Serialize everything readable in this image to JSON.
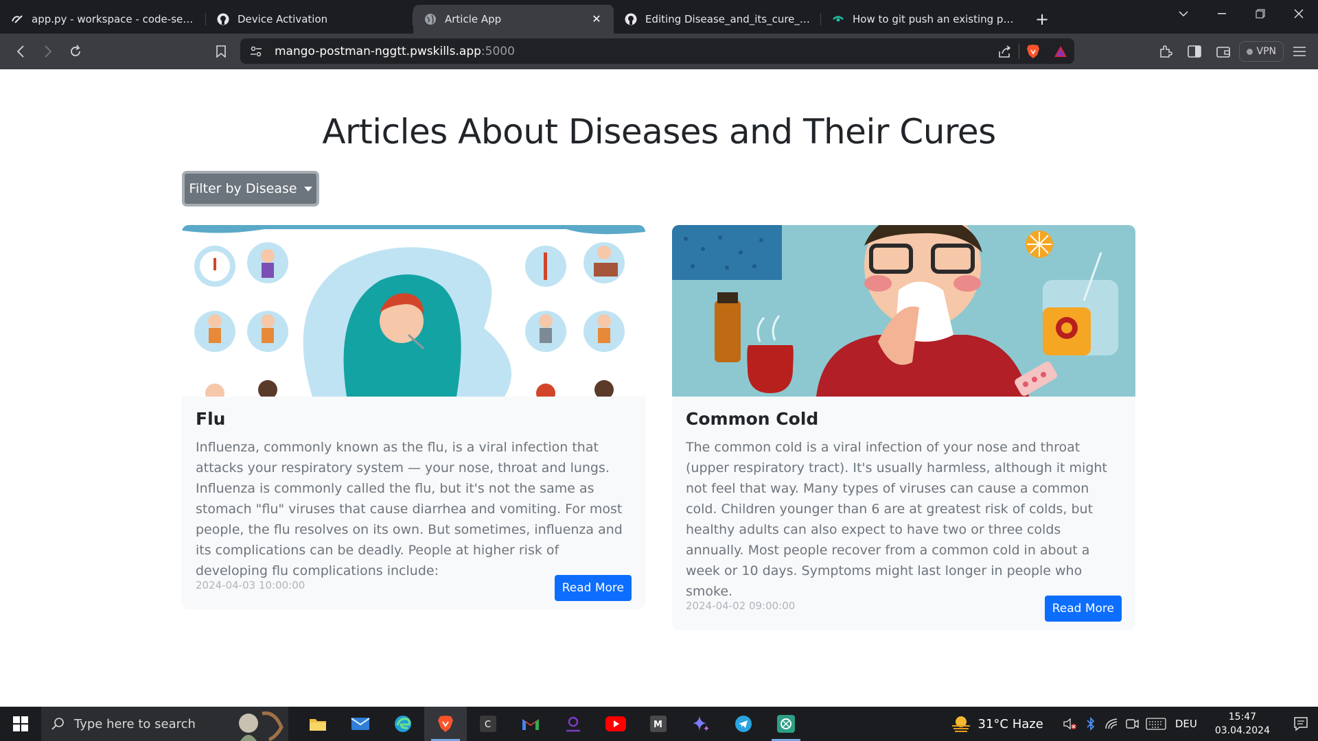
{
  "browser": {
    "tabs": [
      {
        "label": "app.py - workspace - code-server",
        "icon": "code-server-icon",
        "active": false
      },
      {
        "label": "Device Activation",
        "icon": "github-icon",
        "active": false
      },
      {
        "label": "Article App",
        "icon": "globe-icon",
        "active": true
      },
      {
        "label": "Editing Disease_and_its_cure_flask_ap",
        "icon": "github-icon",
        "active": false
      },
      {
        "label": "How to git push an existing project t",
        "icon": "chatbot-icon",
        "active": false
      }
    ],
    "url_host": "mango-postman-nggtt.pwskills.app",
    "url_port": ":5000",
    "vpn_label": "VPN"
  },
  "page": {
    "title": "Articles About Diseases and Their Cures",
    "filter_label": "Filter by Disease",
    "articles": [
      {
        "title": "Flu",
        "body": "Influenza, commonly known as the flu, is a viral infection that attacks your respiratory system — your nose, throat and lungs. Influenza is commonly called the flu, but it's not the same as stomach \"flu\" viruses that cause diarrhea and vomiting. For most people, the flu resolves on its own. But sometimes, influenza and its complications can be deadly. People at higher risk of developing flu complications include:",
        "date": "2024-04-03 10:00:00",
        "button": "Read More"
      },
      {
        "title": "Common Cold",
        "body": "The common cold is a viral infection of your nose and throat (upper respiratory tract). It's usually harmless, although it might not feel that way. Many types of viruses can cause a common cold. Children younger than 6 are at greatest risk of colds, but healthy adults can also expect to have two or three colds annually. Most people recover from a common cold in about a week or 10 days. Symptoms might last longer in people who smoke.",
        "date": "2024-04-02 09:00:00",
        "button": "Read More"
      }
    ]
  },
  "taskbar": {
    "search_placeholder": "Type here to search",
    "weather": "31°C  Haze",
    "language": "DEU",
    "time": "15:47",
    "date": "03.04.2024"
  },
  "colors": {
    "primary": "#0d6efd",
    "secondary": "#6c757d",
    "card_bg": "#f8f9fa",
    "chrome_dark": "#1c1d22"
  }
}
